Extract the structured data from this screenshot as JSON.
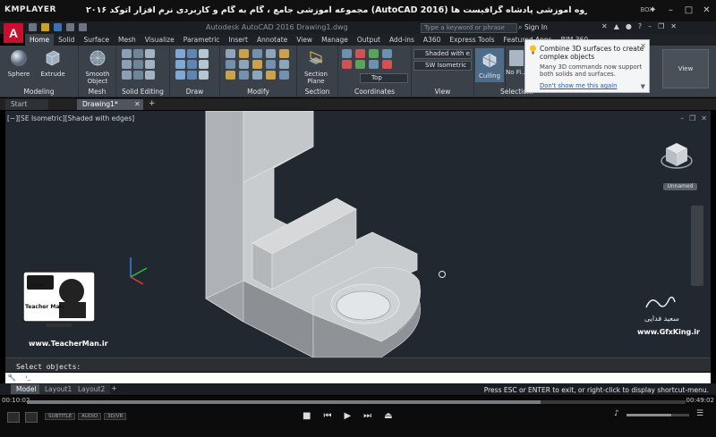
{
  "player": {
    "name": "KMPLAYER",
    "title": "مجموعه آموزشی جامع ، گام به گام و کاربردی نرم افزار  اتوکد ۲۰۱۶ (AutoCAD 2016)  مدرس : سعید فدایی (تیچرمن ) گروه آموزشی پادشاه گرافیست ها",
    "box_label": "BOX",
    "time_current": "00:10:02",
    "time_total": "00:49:02",
    "progress": 0.78,
    "sub_labels": [
      "SUBTITLE",
      "AUDIO",
      "3D/VR"
    ]
  },
  "acad": {
    "app_letter": "A",
    "title": "Autodesk AutoCAD 2016    Drawing1.dwg",
    "search_placeholder": "Type a keyword or phrase",
    "sign_in": "Sign In",
    "tabs": [
      "Home",
      "Solid",
      "Surface",
      "Mesh",
      "Visualize",
      "Parametric",
      "Insert",
      "Annotate",
      "View",
      "Manage",
      "Output",
      "Add-ins",
      "A360",
      "Express Tools",
      "Featured Apps",
      "BIM 360"
    ],
    "active_tab": "Home",
    "ribbon": {
      "modeling": {
        "label": "Modeling",
        "sphere": "Sphere",
        "extrude": "Extrude"
      },
      "mesh": {
        "label": "Mesh",
        "smooth": "Smooth Object"
      },
      "solid_editing": {
        "label": "Solid Editing"
      },
      "draw": {
        "label": "Draw"
      },
      "modify": {
        "label": "Modify"
      },
      "section": {
        "label": "Section",
        "plane": "Section Plane"
      },
      "coordinates": {
        "label": "Coordinates",
        "top": "Top"
      },
      "view": {
        "label": "View",
        "visual_style": "Shaded with e...",
        "view_name": "SW Isometric"
      },
      "culling": "Culling",
      "no_filter": "No Fi...",
      "selection": "Selectio..."
    },
    "tooltip": {
      "title": "Combine 3D surfaces to create complex objects",
      "body": "Many 3D commands now support both solids and surfaces.",
      "link": "Don't show me this again"
    },
    "doc_tabs": [
      "Start",
      "Drawing1*"
    ],
    "viewport_label": "[−][SE Isometric][Shaded with edges]",
    "viewcube": {
      "face": "TOP",
      "unnamed": "Unnamed"
    },
    "command_text": "Select objects:",
    "command_prompt": "Type a command",
    "layout_tabs": [
      "Model",
      "Layout1",
      "Layout2"
    ],
    "status_message": "Press ESC or ENTER to exit, or right-click to display shortcut-menu."
  },
  "watermark": {
    "teacher_brand": "Teacher Man",
    "teacher_fa": "تیچرمن",
    "teacher_url": "www.TeacherMan.ir",
    "gfx_name": "سعید فدایی",
    "gfx_url": "www.GfxKing.ir"
  }
}
